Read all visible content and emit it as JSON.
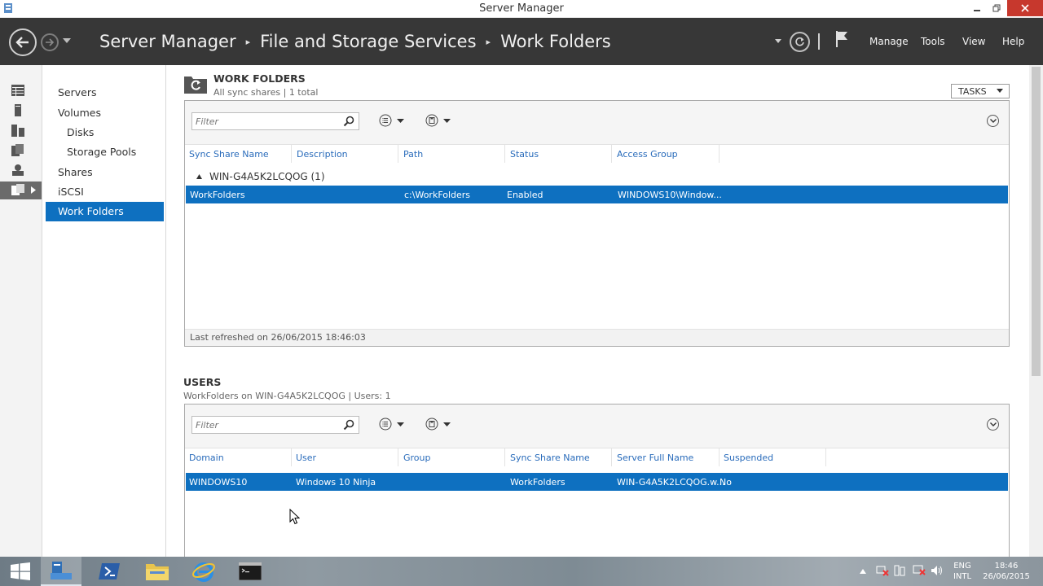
{
  "window": {
    "title": "Server Manager"
  },
  "breadcrumb": [
    "Server Manager",
    "File and Storage Services",
    "Work Folders"
  ],
  "menu": {
    "manage": "Manage",
    "tools": "Tools",
    "view": "View",
    "help": "Help"
  },
  "nav": {
    "servers": "Servers",
    "volumes": "Volumes",
    "disks": "Disks",
    "storage_pools": "Storage Pools",
    "shares": "Shares",
    "iscsi": "iSCSI",
    "work_folders": "Work Folders"
  },
  "work_folders": {
    "title": "WORK FOLDERS",
    "subtitle": "All sync shares | 1 total",
    "tasks": "TASKS",
    "filter_placeholder": "Filter",
    "columns": [
      "Sync Share Name",
      "Description",
      "Path",
      "Status",
      "Access Group"
    ],
    "group": "WIN-G4A5K2LCQOG (1)",
    "row": {
      "sync_share_name": "WorkFolders",
      "description": "",
      "path": "c:\\WorkFolders",
      "status": "Enabled",
      "access_group": "WINDOWS10\\Window..."
    },
    "last_refreshed": "Last refreshed on 26/06/2015 18:46:03"
  },
  "users": {
    "title": "USERS",
    "subtitle": "WorkFolders on WIN-G4A5K2LCQOG | Users: 1",
    "filter_placeholder": "Filter",
    "columns": [
      "Domain",
      "User",
      "Group",
      "Sync Share Name",
      "Server Full Name",
      "Suspended"
    ],
    "row": {
      "domain": "WINDOWS10",
      "user": "Windows 10 Ninja",
      "group": "",
      "sync_share_name": "WorkFolders",
      "server_full_name": "WIN-G4A5K2LCQOG.w...",
      "suspended": "No"
    }
  },
  "taskbar": {
    "lang_top": "ENG",
    "lang_bottom": "INTL",
    "time": "18:46",
    "date": "26/06/2015"
  },
  "colors": {
    "selection": "#0e70c0",
    "header": "#373737",
    "close": "#c7382d"
  }
}
